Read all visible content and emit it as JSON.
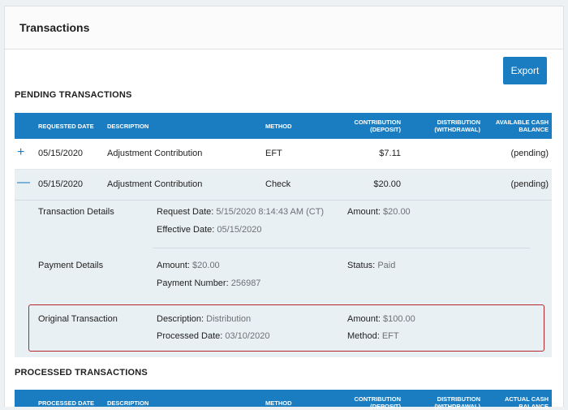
{
  "header": {
    "title": "Transactions"
  },
  "toolbar": {
    "export_label": "Export"
  },
  "pending": {
    "title": "PENDING TRANSACTIONS",
    "columns": {
      "date": "REQUESTED DATE",
      "description": "DESCRIPTION",
      "method": "METHOD",
      "contribution": [
        "CONTRIBUTION",
        "(DEPOSIT)"
      ],
      "distribution": [
        "DISTRIBUTION",
        "(WITHDRAWAL)"
      ],
      "balance": [
        "AVAILABLE CASH",
        "BALANCE"
      ]
    },
    "rows": [
      {
        "toggle": "+",
        "date": "05/15/2020",
        "description": "Adjustment Contribution",
        "method": "EFT",
        "contribution": "$7.11",
        "distribution": "",
        "balance": "(pending)"
      },
      {
        "toggle": "—",
        "date": "05/15/2020",
        "description": "Adjustment Contribution",
        "method": "Check",
        "contribution": "$20.00",
        "distribution": "",
        "balance": "(pending)"
      }
    ],
    "details": {
      "transaction": {
        "label": "Transaction Details",
        "request_date_key": "Request Date:",
        "request_date": "5/15/2020 8:14:43 AM (CT)",
        "effective_date_key": "Effective Date:",
        "effective_date": "05/15/2020",
        "amount_key": "Amount:",
        "amount": "$20.00"
      },
      "payment": {
        "label": "Payment Details",
        "amount_key": "Amount:",
        "amount": "$20.00",
        "payment_number_key": "Payment Number:",
        "payment_number": "256987",
        "status_key": "Status:",
        "status": "Paid"
      },
      "original": {
        "label": "Original Transaction",
        "description_key": "Description:",
        "description": "Distribution",
        "processed_date_key": "Processed Date:",
        "processed_date": "03/10/2020",
        "amount_key": "Amount:",
        "amount": "$100.00",
        "method_key": "Method:",
        "method": "EFT"
      }
    }
  },
  "processed": {
    "title": "PROCESSED TRANSACTIONS",
    "columns": {
      "date": "PROCESSED DATE",
      "description": "DESCRIPTION",
      "method": "METHOD",
      "contribution": [
        "CONTRIBUTION",
        "(DEPOSIT)"
      ],
      "distribution": [
        "DISTRIBUTION",
        "(WITHDRAWAL)"
      ],
      "balance": [
        "ACTUAL CASH",
        "BALANCE"
      ]
    }
  },
  "colors": {
    "accent": "#1a7dc1",
    "highlight": "#b5262e",
    "detail_bg": "#e9f0f3"
  }
}
